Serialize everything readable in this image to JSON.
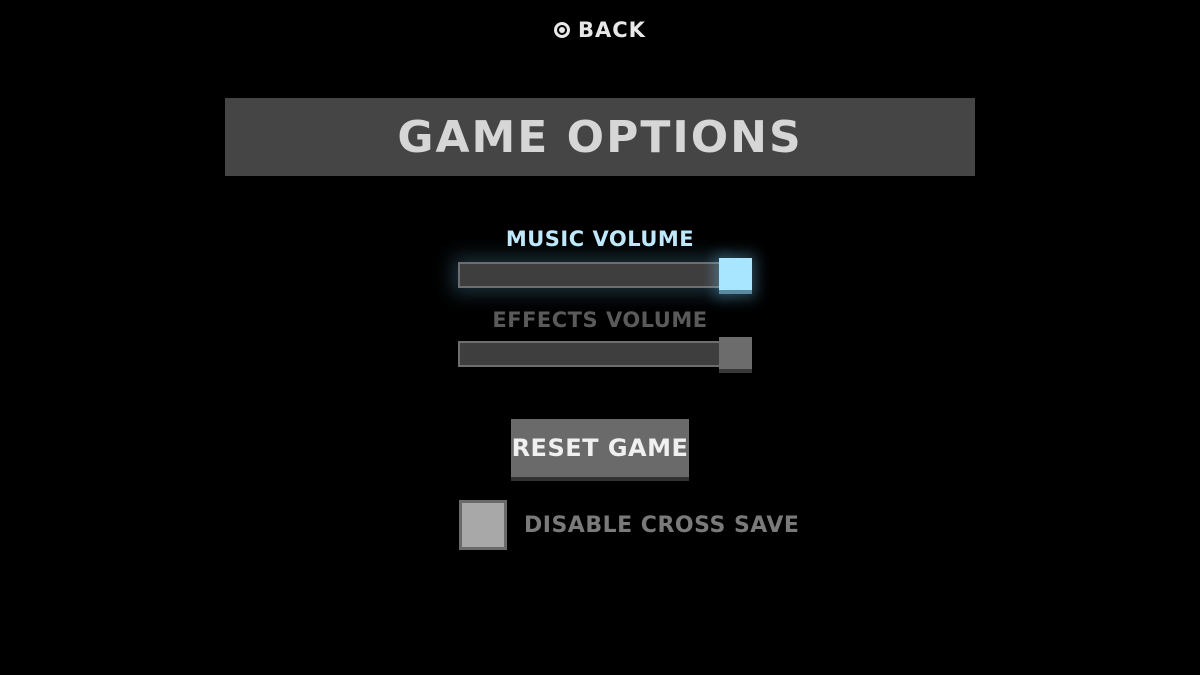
{
  "header": {
    "back_label": "BACK",
    "back_icon": "circle-button-icon"
  },
  "title": "GAME OPTIONS",
  "settings": {
    "music_volume": {
      "label": "MUSIC VOLUME",
      "level": 1.0,
      "state": "focused"
    },
    "effects_volume": {
      "label": "EFFECTS VOLUME",
      "level": 1.0,
      "state": "normal"
    }
  },
  "reset_button": {
    "label": "RESET GAME"
  },
  "cross_save": {
    "label": "DISABLE CROSS SAVE",
    "checked": false
  },
  "colors": {
    "background": "#000000",
    "banner": "#454545",
    "focus_accent": "#a8e6ff",
    "inactive_text": "#5a5a5a"
  }
}
